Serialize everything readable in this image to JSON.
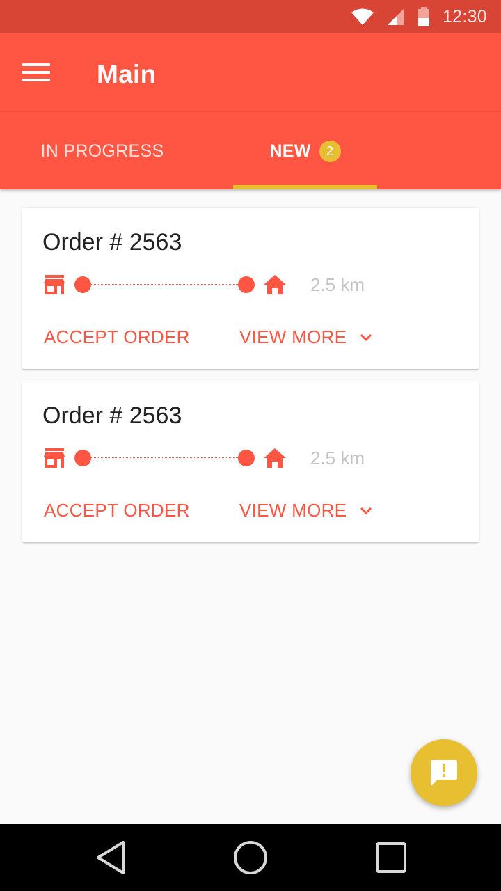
{
  "status_bar": {
    "time": "12:30"
  },
  "app_bar": {
    "title": "Main"
  },
  "tabs": [
    {
      "label": "IN PROGRESS",
      "selected": false
    },
    {
      "label": "NEW",
      "badge": "2",
      "selected": true
    }
  ],
  "orders": [
    {
      "title": "Order # 2563",
      "distance": "2.5 km",
      "accept_label": "ACCEPT ORDER",
      "view_more_label": "VIEW MORE"
    },
    {
      "title": "Order # 2563",
      "distance": "2.5 km",
      "accept_label": "ACCEPT ORDER",
      "view_more_label": "VIEW MORE"
    }
  ],
  "fab": {
    "icon": "feedback-icon"
  },
  "nav_bar": {
    "back_icon": "back-triangle-icon",
    "home_icon": "home-circle-icon",
    "recents_icon": "recents-square-icon"
  },
  "colors": {
    "primary": "#ff5543",
    "primary_dark": "#d84535",
    "accent": "#e9bf32",
    "muted_text": "#c4c4c4"
  }
}
